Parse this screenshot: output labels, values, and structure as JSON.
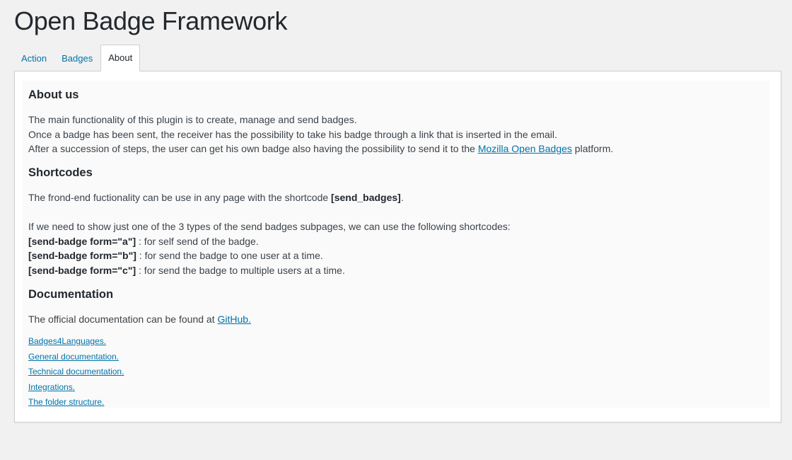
{
  "header": {
    "title": "Open Badge Framework"
  },
  "tabs": [
    {
      "label": "Action"
    },
    {
      "label": "Badges"
    },
    {
      "label": "About",
      "active": true
    }
  ],
  "about": {
    "heading": "About us",
    "line1": "The main functionality of this plugin is to create, manage and send badges.",
    "line2": "Once a badge has been sent, the receiver has the possibility to take his badge through a link that is inserted in the email.",
    "line3_before": "After a succession of steps, the user can get his own badge also having the possibility to send it to the ",
    "line3_link": "Mozilla Open Badges",
    "line3_after": " platform."
  },
  "shortcodes": {
    "heading": "Shortcodes",
    "intro_before": "The frond-end fuctionality can be use in any page with the shortcode ",
    "intro_code": "[send_badges]",
    "intro_after": ".",
    "list_intro": "If we need to show just one of the 3 types of the send badges subpages, we can use the following shortcodes:",
    "items": [
      {
        "code": "[send-badge form=\"a\"]",
        "desc": " : for self send of the badge."
      },
      {
        "code": "[send-badge form=\"b\"]",
        "desc": " : for send the badge to one user at a time."
      },
      {
        "code": "[send-badge form=\"c\"]",
        "desc": " : for send the badge to multiple users at a time."
      }
    ]
  },
  "documentation": {
    "heading": "Documentation",
    "text_before": "The official documentation can be found at ",
    "text_link": "GitHub.",
    "links": [
      "Badges4Languages.",
      "General documentation.",
      "Technical documentation.",
      "Integrations.",
      "The folder structure."
    ]
  },
  "colors": {
    "link": "#0073aa",
    "background": "#f1f1f1",
    "panel": "#ffffff",
    "inner_panel": "#fafafa"
  }
}
